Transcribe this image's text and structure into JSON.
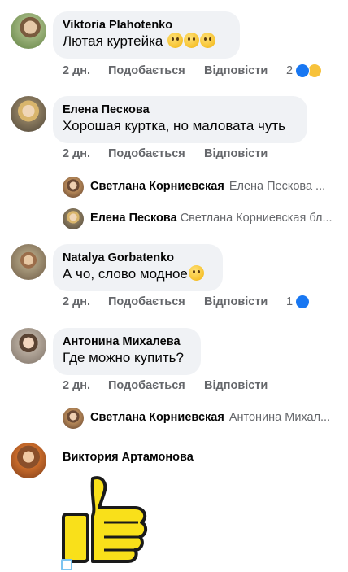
{
  "comments": [
    {
      "author": "Viktoria  Plahotenko",
      "text": "Лютая куртейка",
      "emojis": [
        "rolling-eyes-emoji",
        "grin-emoji",
        "laughing-tears-emoji"
      ],
      "time": "2 дн.",
      "like_label": "Подобається",
      "reply_label": "Відповісти",
      "reaction_count": "2",
      "reactions": [
        "like",
        "haha"
      ]
    },
    {
      "author": "Елена Пескова",
      "text": "Хорошая куртка, но маловата чуть",
      "time": "2 дн.",
      "like_label": "Подобається",
      "reply_label": "Відповісти",
      "replies": [
        {
          "author": "Светлана Корниевская",
          "preview": "Елена Пескова ..."
        },
        {
          "author": "Елена Пескова",
          "preview": "Светлана Корниевская бл..."
        }
      ]
    },
    {
      "author": "Natalya  Gorbatenko",
      "text": "А чо, слово модное",
      "emojis": [
        "thinking-emoji"
      ],
      "time": "2 дн.",
      "like_label": "Подобається",
      "reply_label": "Відповісти",
      "reaction_count": "1",
      "reactions": [
        "like"
      ]
    },
    {
      "author": "Антонина Михалева",
      "text": "Где можно купить?",
      "time": "2 дн.",
      "like_label": "Подобається",
      "reply_label": "Відповісти",
      "replies": [
        {
          "author": "Светлана Корниевская",
          "preview": "Антонина Михал..."
        }
      ]
    },
    {
      "author": "Виктория Артамонова",
      "sticker": "thumbs-up-sticker"
    }
  ],
  "colors": {
    "bubble": "#f0f2f5",
    "meta_text": "#65676b",
    "like_blue": "#1877f2",
    "haha_yellow": "#f7c23b",
    "sticker_yellow": "#f9e01a"
  }
}
